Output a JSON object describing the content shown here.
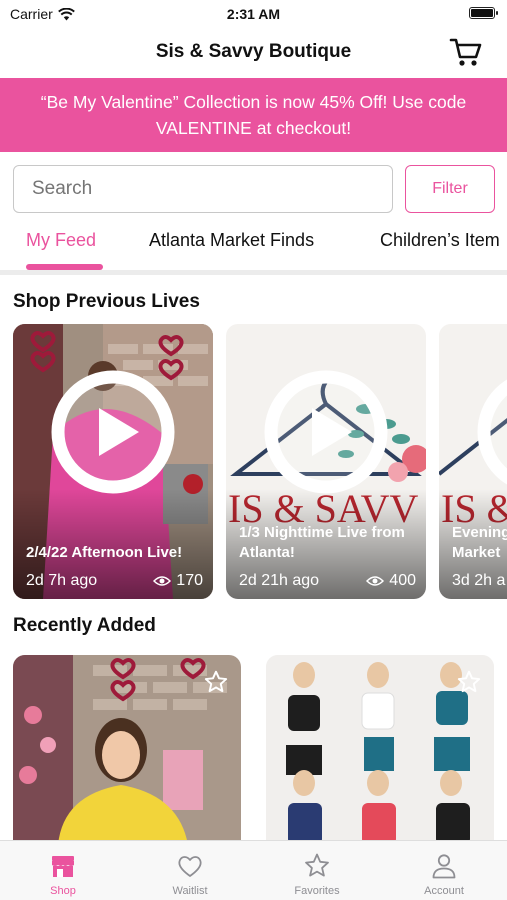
{
  "status_bar": {
    "carrier": "Carrier",
    "time": "2:31 AM"
  },
  "nav": {
    "title": "Sis & Savvy Boutique"
  },
  "promo": {
    "text": "“Be My Valentine” Collection is now 45% Off! Use code VALENTINE at checkout!"
  },
  "search": {
    "placeholder": "Search",
    "filter_label": "Filter"
  },
  "tabs": [
    {
      "label": "My Feed",
      "active": true
    },
    {
      "label": "Atlanta Market Finds",
      "active": false
    },
    {
      "label": "Children’s Item",
      "active": false
    }
  ],
  "previous_lives": {
    "title": "Shop Previous Lives",
    "items": [
      {
        "title": "2/4/22 Afternoon Live!",
        "age": "2d 7h ago",
        "views": "170"
      },
      {
        "title": "1/3 Nighttime Live from Atlanta!",
        "age": "2d 21h ago",
        "views": "400"
      },
      {
        "title": "Evening Market",
        "age": "3d 2h a",
        "views": ""
      }
    ]
  },
  "recently_added": {
    "title": "Recently Added"
  },
  "tab_bar": [
    {
      "label": "Shop",
      "icon": "shop-icon",
      "active": true
    },
    {
      "label": "Waitlist",
      "icon": "heart-icon",
      "active": false
    },
    {
      "label": "Favorites",
      "icon": "star-icon",
      "active": false
    },
    {
      "label": "Account",
      "icon": "person-icon",
      "active": false
    }
  ],
  "colors": {
    "accent": "#ea539e",
    "tab_inactive": "#8e8e93",
    "divider": "#ececec"
  }
}
